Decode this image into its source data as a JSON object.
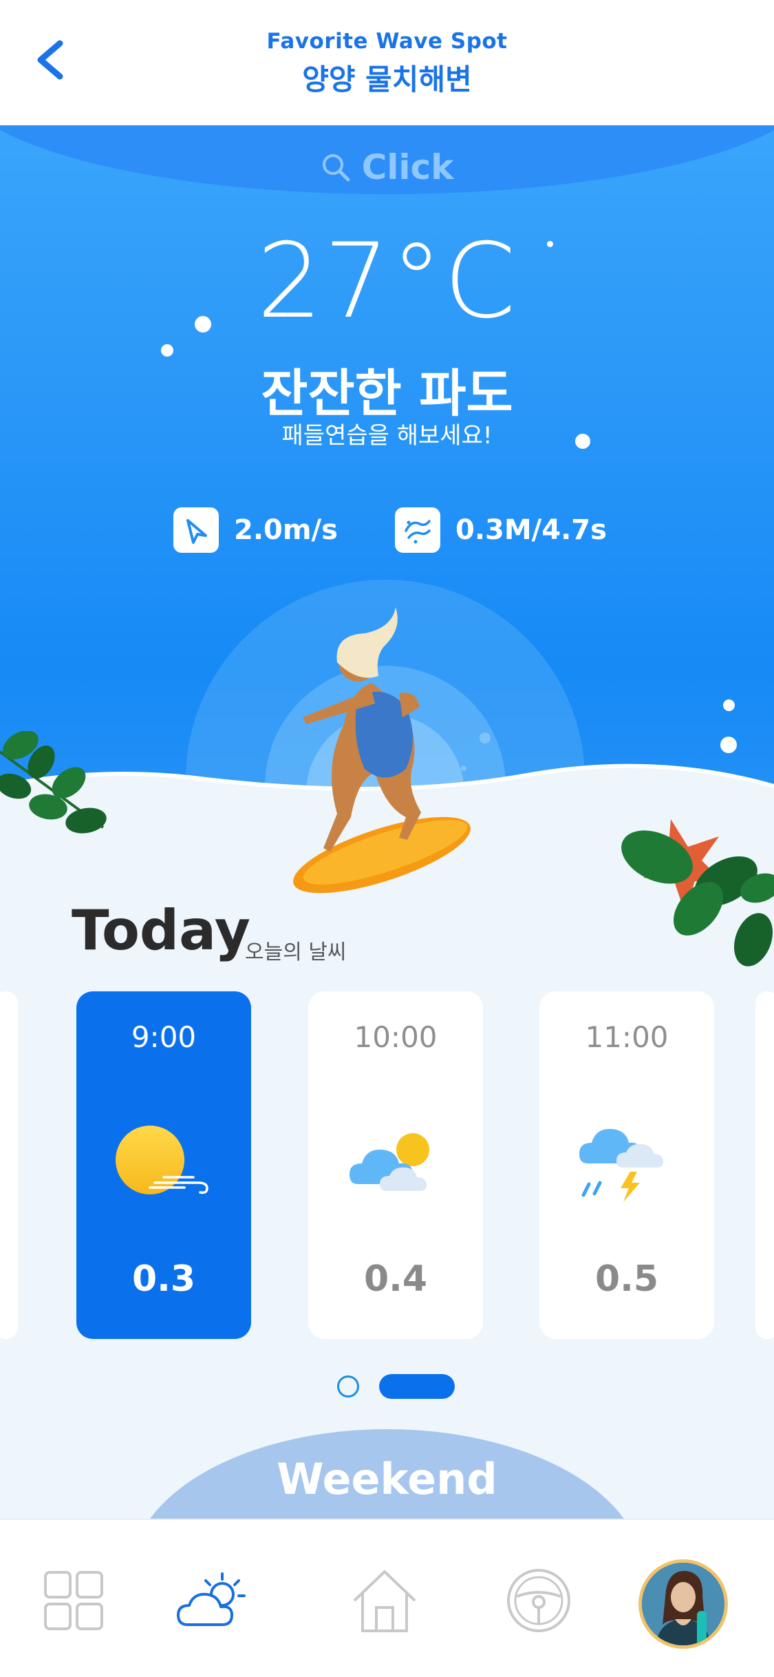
{
  "header": {
    "subtitle": "Favorite Wave Spot",
    "title": "양양 물치해변"
  },
  "search": {
    "label": "Click"
  },
  "weather": {
    "temperature": "27°C",
    "condition": "잔잔한 파도",
    "advice": "패들연습을 해보세요!",
    "wind": "2.0m/s",
    "wave": "0.3M/4.7s"
  },
  "today": {
    "title": "Today",
    "subtitle": "오늘의 날씨",
    "cards": [
      {
        "time": "9:00",
        "value": "0.3",
        "icon": "sun-wind-icon",
        "active": true
      },
      {
        "time": "10:00",
        "value": "0.4",
        "icon": "partly-cloudy-icon",
        "active": false
      },
      {
        "time": "11:00",
        "value": "0.5",
        "icon": "thunderstorm-icon",
        "active": false
      }
    ]
  },
  "weekend": {
    "label": "Weekend"
  },
  "nav": {
    "items": [
      "grid-icon",
      "weather-icon",
      "home-icon",
      "steering-wheel-icon",
      "profile-avatar"
    ]
  },
  "colors": {
    "accent": "#0b70ec",
    "sky": "#2a97f8",
    "header_text": "#1a74e8",
    "background": "#eef6fc"
  }
}
